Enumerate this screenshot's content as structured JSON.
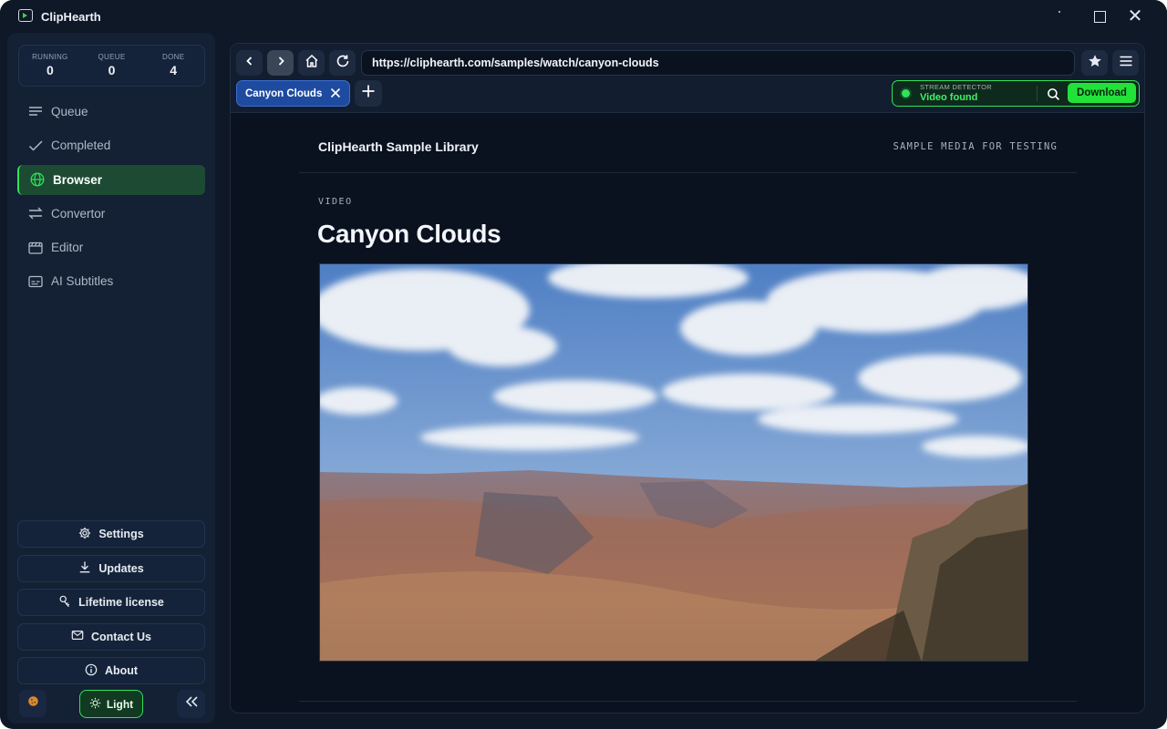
{
  "app": {
    "title": "ClipHearth"
  },
  "stats": [
    {
      "label": "RUNNING",
      "value": "0"
    },
    {
      "label": "QUEUE",
      "value": "0"
    },
    {
      "label": "DONE",
      "value": "4"
    }
  ],
  "nav": [
    {
      "label": "Queue",
      "icon": "list-icon",
      "active": false
    },
    {
      "label": "Completed",
      "icon": "check-icon",
      "active": false
    },
    {
      "label": "Browser",
      "icon": "globe-icon",
      "active": true
    },
    {
      "label": "Convertor",
      "icon": "swap-icon",
      "active": false
    },
    {
      "label": "Editor",
      "icon": "clapperboard-icon",
      "active": false
    },
    {
      "label": "AI Subtitles",
      "icon": "subtitles-icon",
      "active": false
    }
  ],
  "bottom": {
    "settings": "Settings",
    "updates": "Updates",
    "license": "Lifetime license",
    "contact": "Contact Us",
    "about": "About",
    "theme": "Light"
  },
  "browser": {
    "url": "https://cliphearth.com/samples/watch/canyon-clouds",
    "tab_title": "Canyon Clouds",
    "detector_label": "STREAM DETECTOR",
    "detector_status": "Video found",
    "download": "Download"
  },
  "page": {
    "site_name": "ClipHearth Sample Library",
    "site_tagline": "SAMPLE MEDIA FOR TESTING",
    "section": "VIDEO",
    "title": "Canyon Clouds"
  },
  "colors": {
    "accent_green": "#2ee25a",
    "tab_blue": "#1e4ba0",
    "background": "#0f1826"
  }
}
